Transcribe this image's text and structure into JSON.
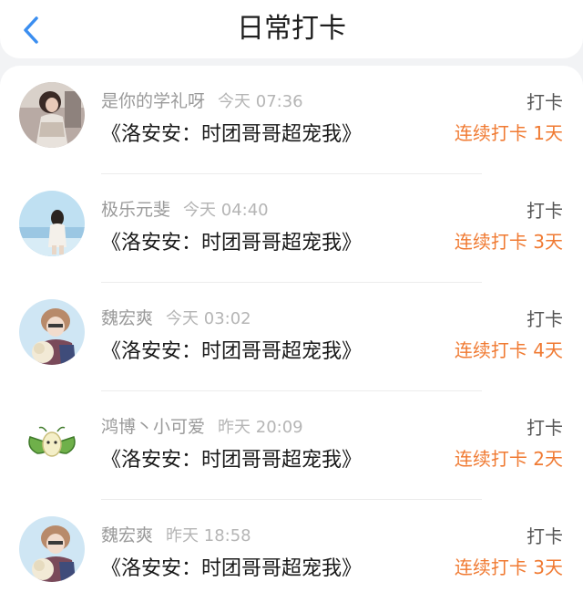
{
  "header": {
    "title": "日常打卡"
  },
  "entries": [
    {
      "user": "是你的学礼呀",
      "time": "今天 07:36",
      "book": "《洛安安：时团哥哥超宠我》",
      "tag": "打卡",
      "streak": "连续打卡 1天"
    },
    {
      "user": "极乐元斐",
      "time": "今天 04:40",
      "book": "《洛安安：时团哥哥超宠我》",
      "tag": "打卡",
      "streak": "连续打卡 3天"
    },
    {
      "user": "魏宏爽",
      "time": "今天 03:02",
      "book": "《洛安安：时团哥哥超宠我》",
      "tag": "打卡",
      "streak": "连续打卡 4天"
    },
    {
      "user": "鸿博丶小可爱",
      "time": "昨天 20:09",
      "book": "《洛安安：时团哥哥超宠我》",
      "tag": "打卡",
      "streak": "连续打卡 2天"
    },
    {
      "user": "魏宏爽",
      "time": "昨天 18:58",
      "book": "《洛安安：时团哥哥超宠我》",
      "tag": "打卡",
      "streak": "连续打卡 3天"
    }
  ],
  "colors": {
    "accent": "#f07a32",
    "back": "#3b8ef0",
    "muted": "#9a9a9a"
  }
}
